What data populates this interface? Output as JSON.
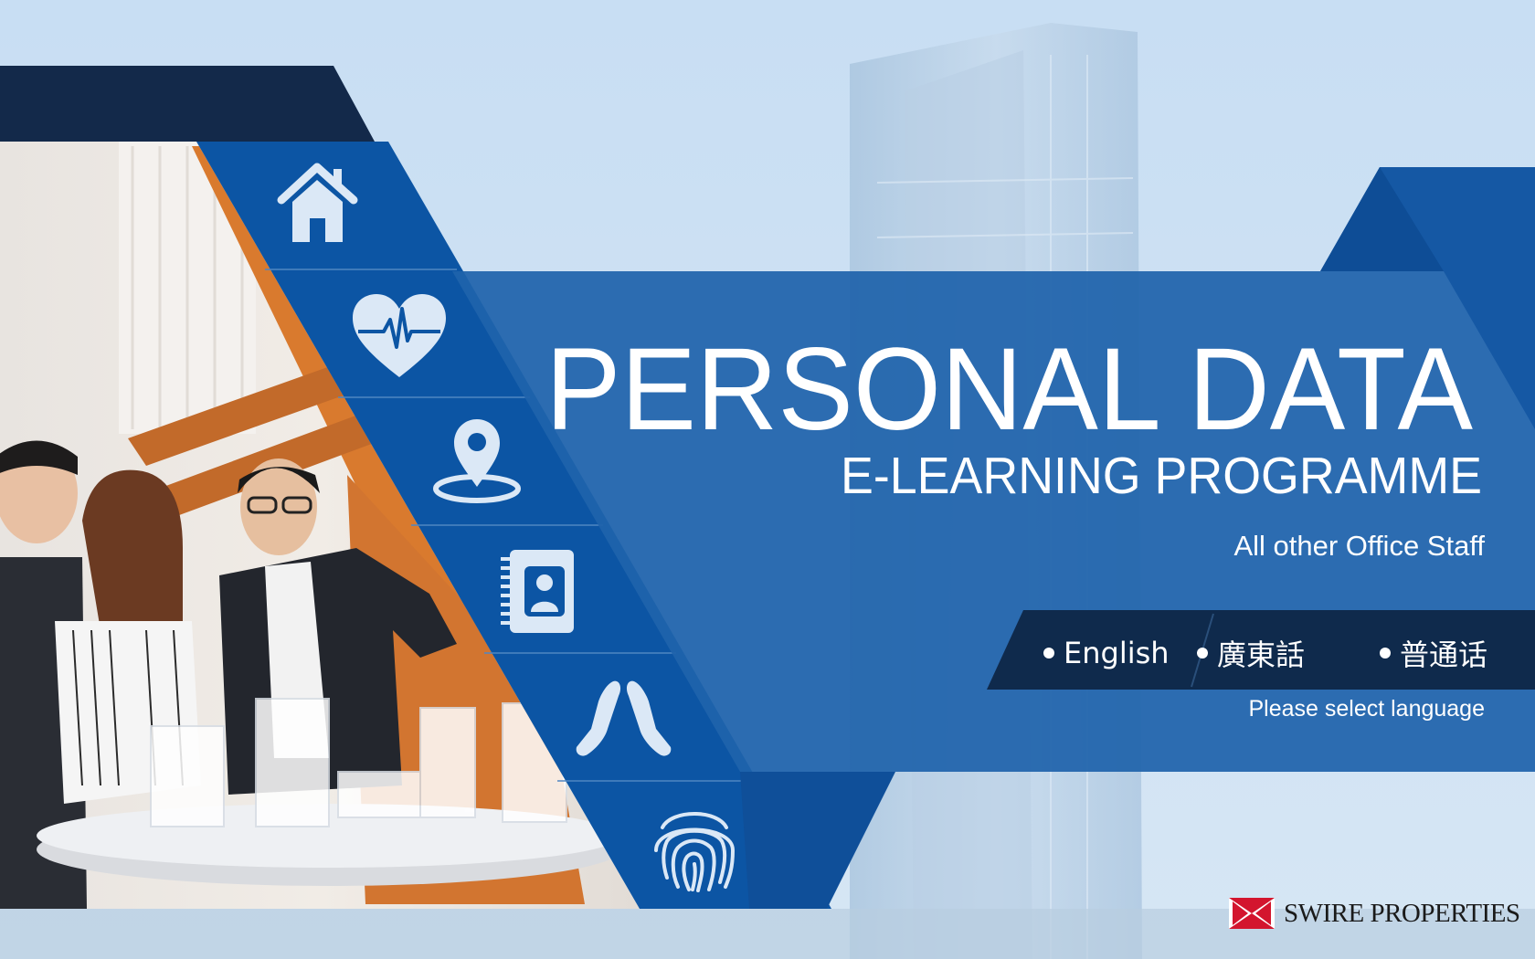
{
  "title": "PERSONAL DATA",
  "subtitle": "E-LEARNING PROGRAMME",
  "audience": "All other Office Staff",
  "languages": [
    {
      "label": "English"
    },
    {
      "label": "廣東話"
    },
    {
      "label": "普通话"
    }
  ],
  "language_prompt": "Please select language",
  "brand": {
    "name": "SWIRE PROPERTIES",
    "logo_colors": [
      "#d3152e",
      "#ffffff"
    ]
  },
  "icons": [
    "home-icon",
    "heart-pulse-icon",
    "location-pin-icon",
    "contact-book-icon",
    "hands-icon",
    "fingerprint-icon"
  ],
  "colors": {
    "background_sky": "#c9def2",
    "dark_navy": "#12294a",
    "strip_blue": "#0c56a4",
    "panel_blue": "#1f66b0",
    "lang_bar": "#102a4a"
  }
}
